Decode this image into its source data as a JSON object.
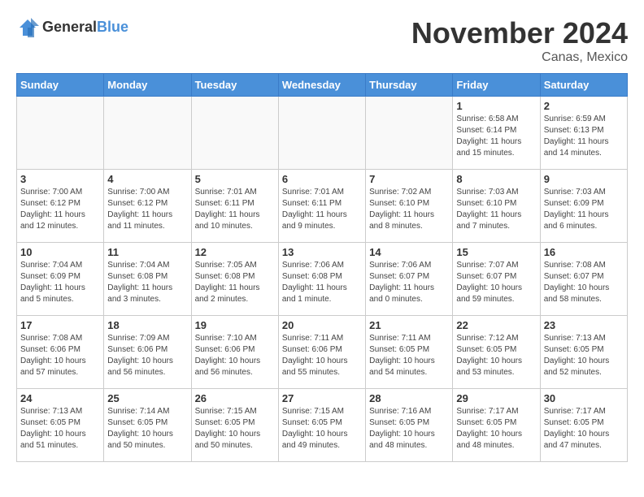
{
  "header": {
    "logo_general": "General",
    "logo_blue": "Blue",
    "title": "November 2024",
    "location": "Canas, Mexico"
  },
  "days_of_week": [
    "Sunday",
    "Monday",
    "Tuesday",
    "Wednesday",
    "Thursday",
    "Friday",
    "Saturday"
  ],
  "weeks": [
    [
      {
        "day": "",
        "info": ""
      },
      {
        "day": "",
        "info": ""
      },
      {
        "day": "",
        "info": ""
      },
      {
        "day": "",
        "info": ""
      },
      {
        "day": "",
        "info": ""
      },
      {
        "day": "1",
        "info": "Sunrise: 6:58 AM\nSunset: 6:14 PM\nDaylight: 11 hours and 15 minutes."
      },
      {
        "day": "2",
        "info": "Sunrise: 6:59 AM\nSunset: 6:13 PM\nDaylight: 11 hours and 14 minutes."
      }
    ],
    [
      {
        "day": "3",
        "info": "Sunrise: 7:00 AM\nSunset: 6:12 PM\nDaylight: 11 hours and 12 minutes."
      },
      {
        "day": "4",
        "info": "Sunrise: 7:00 AM\nSunset: 6:12 PM\nDaylight: 11 hours and 11 minutes."
      },
      {
        "day": "5",
        "info": "Sunrise: 7:01 AM\nSunset: 6:11 PM\nDaylight: 11 hours and 10 minutes."
      },
      {
        "day": "6",
        "info": "Sunrise: 7:01 AM\nSunset: 6:11 PM\nDaylight: 11 hours and 9 minutes."
      },
      {
        "day": "7",
        "info": "Sunrise: 7:02 AM\nSunset: 6:10 PM\nDaylight: 11 hours and 8 minutes."
      },
      {
        "day": "8",
        "info": "Sunrise: 7:03 AM\nSunset: 6:10 PM\nDaylight: 11 hours and 7 minutes."
      },
      {
        "day": "9",
        "info": "Sunrise: 7:03 AM\nSunset: 6:09 PM\nDaylight: 11 hours and 6 minutes."
      }
    ],
    [
      {
        "day": "10",
        "info": "Sunrise: 7:04 AM\nSunset: 6:09 PM\nDaylight: 11 hours and 5 minutes."
      },
      {
        "day": "11",
        "info": "Sunrise: 7:04 AM\nSunset: 6:08 PM\nDaylight: 11 hours and 3 minutes."
      },
      {
        "day": "12",
        "info": "Sunrise: 7:05 AM\nSunset: 6:08 PM\nDaylight: 11 hours and 2 minutes."
      },
      {
        "day": "13",
        "info": "Sunrise: 7:06 AM\nSunset: 6:08 PM\nDaylight: 11 hours and 1 minute."
      },
      {
        "day": "14",
        "info": "Sunrise: 7:06 AM\nSunset: 6:07 PM\nDaylight: 11 hours and 0 minutes."
      },
      {
        "day": "15",
        "info": "Sunrise: 7:07 AM\nSunset: 6:07 PM\nDaylight: 10 hours and 59 minutes."
      },
      {
        "day": "16",
        "info": "Sunrise: 7:08 AM\nSunset: 6:07 PM\nDaylight: 10 hours and 58 minutes."
      }
    ],
    [
      {
        "day": "17",
        "info": "Sunrise: 7:08 AM\nSunset: 6:06 PM\nDaylight: 10 hours and 57 minutes."
      },
      {
        "day": "18",
        "info": "Sunrise: 7:09 AM\nSunset: 6:06 PM\nDaylight: 10 hours and 56 minutes."
      },
      {
        "day": "19",
        "info": "Sunrise: 7:10 AM\nSunset: 6:06 PM\nDaylight: 10 hours and 56 minutes."
      },
      {
        "day": "20",
        "info": "Sunrise: 7:11 AM\nSunset: 6:06 PM\nDaylight: 10 hours and 55 minutes."
      },
      {
        "day": "21",
        "info": "Sunrise: 7:11 AM\nSunset: 6:05 PM\nDaylight: 10 hours and 54 minutes."
      },
      {
        "day": "22",
        "info": "Sunrise: 7:12 AM\nSunset: 6:05 PM\nDaylight: 10 hours and 53 minutes."
      },
      {
        "day": "23",
        "info": "Sunrise: 7:13 AM\nSunset: 6:05 PM\nDaylight: 10 hours and 52 minutes."
      }
    ],
    [
      {
        "day": "24",
        "info": "Sunrise: 7:13 AM\nSunset: 6:05 PM\nDaylight: 10 hours and 51 minutes."
      },
      {
        "day": "25",
        "info": "Sunrise: 7:14 AM\nSunset: 6:05 PM\nDaylight: 10 hours and 50 minutes."
      },
      {
        "day": "26",
        "info": "Sunrise: 7:15 AM\nSunset: 6:05 PM\nDaylight: 10 hours and 50 minutes."
      },
      {
        "day": "27",
        "info": "Sunrise: 7:15 AM\nSunset: 6:05 PM\nDaylight: 10 hours and 49 minutes."
      },
      {
        "day": "28",
        "info": "Sunrise: 7:16 AM\nSunset: 6:05 PM\nDaylight: 10 hours and 48 minutes."
      },
      {
        "day": "29",
        "info": "Sunrise: 7:17 AM\nSunset: 6:05 PM\nDaylight: 10 hours and 48 minutes."
      },
      {
        "day": "30",
        "info": "Sunrise: 7:17 AM\nSunset: 6:05 PM\nDaylight: 10 hours and 47 minutes."
      }
    ]
  ]
}
